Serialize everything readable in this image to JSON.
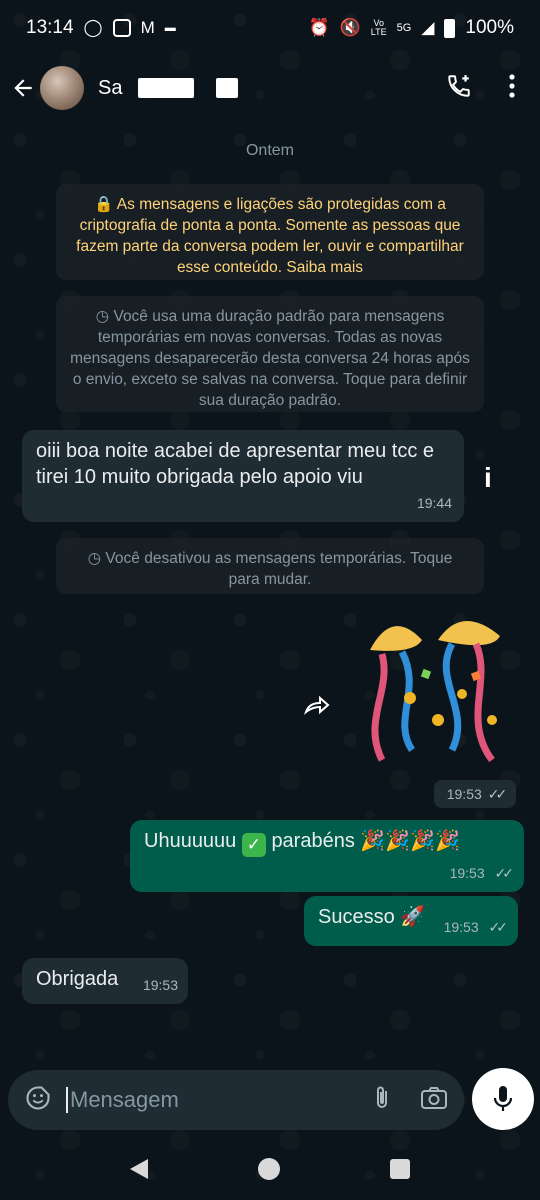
{
  "status_bar": {
    "time": "13:14",
    "battery": "100%",
    "network": "5G",
    "volte": "Vo\nLTE"
  },
  "header": {
    "contact_name": "Sa",
    "back_icon": "arrow-left-icon",
    "call_icon": "add-call-icon",
    "menu_icon": "more-vertical-icon"
  },
  "chat": {
    "date_label": "Ontem",
    "encryption_notice": "🔒 As mensagens e ligações são protegidas com a criptografia de ponta a ponta. Somente as pessoas que fazem parte da conversa podem ler, ouvir e compartilhar esse conteúdo. Saiba mais",
    "temp_notice": "◷ Você usa uma duração padrão para mensagens temporárias em novas conversas. Todas as novas mensagens desaparecerão desta conversa 24 horas após o envio, exceto se salvas na conversa. Toque para definir sua duração padrão.",
    "temp_off_notice": "◷ Você desativou as mensagens temporárias. Toque para mudar.",
    "messages": [
      {
        "direction": "in",
        "text": "oiii boa noite acabei de apresentar meu tcc e tirei 10 muito obrigada pelo apoio viu",
        "time": "19:44"
      },
      {
        "direction": "out",
        "type": "sticker",
        "time": "19:53"
      },
      {
        "direction": "out",
        "text": "Uhuuuuuu",
        "text_after": "parabéns",
        "time": "19:53"
      },
      {
        "direction": "out",
        "text": "Sucesso",
        "time": "19:53"
      },
      {
        "direction": "in",
        "text": "Obrigada",
        "time": "19:53"
      }
    ],
    "info_icon_char": "i"
  },
  "composer": {
    "placeholder": "Mensagem"
  },
  "colors": {
    "background": "#0b141a",
    "outgoing_bubble": "#005c4b",
    "incoming_bubble": "#202c33",
    "encryption_text": "#ffd279"
  }
}
